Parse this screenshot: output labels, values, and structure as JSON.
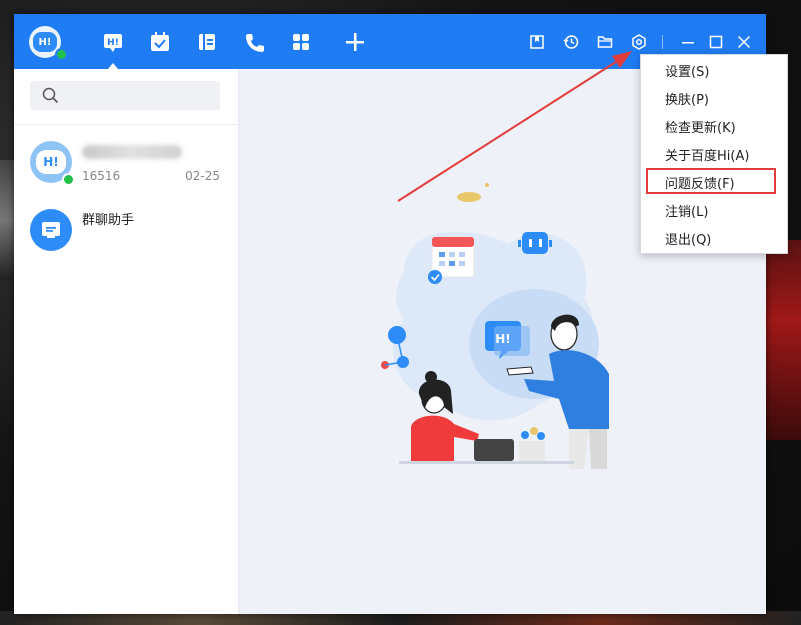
{
  "conversations": [
    {
      "name": "",
      "preview": "16516",
      "time": "02-25",
      "avatar_text": "H!"
    },
    {
      "name": "群聊助手",
      "preview": "",
      "time": ""
    }
  ],
  "search": {
    "placeholder": ""
  },
  "settings_menu": {
    "items": [
      {
        "label": "设置(S)"
      },
      {
        "label": "换肤(P)"
      },
      {
        "label": "检查更新(K)"
      },
      {
        "label": "关于百度Hi(A)"
      },
      {
        "label": "问题反馈(F)"
      },
      {
        "label": "注销(L)"
      },
      {
        "label": "退出(Q)"
      }
    ],
    "highlighted_index": 4
  },
  "titlebar": {
    "nav_icons": [
      "chat-icon",
      "calendar-icon",
      "contacts-icon",
      "phone-icon",
      "apps-icon",
      "add-icon"
    ],
    "tool_icons": [
      "bookmark-icon",
      "history-icon",
      "folder-icon",
      "settings-icon",
      "minimize-icon",
      "maximize-icon",
      "close-icon"
    ],
    "avatar_text": "H!"
  },
  "illustration": {
    "bubble_text": "H!"
  },
  "colors": {
    "brand": "#1f7cf5",
    "annotation": "#e33c3c",
    "online": "#21c04a"
  }
}
